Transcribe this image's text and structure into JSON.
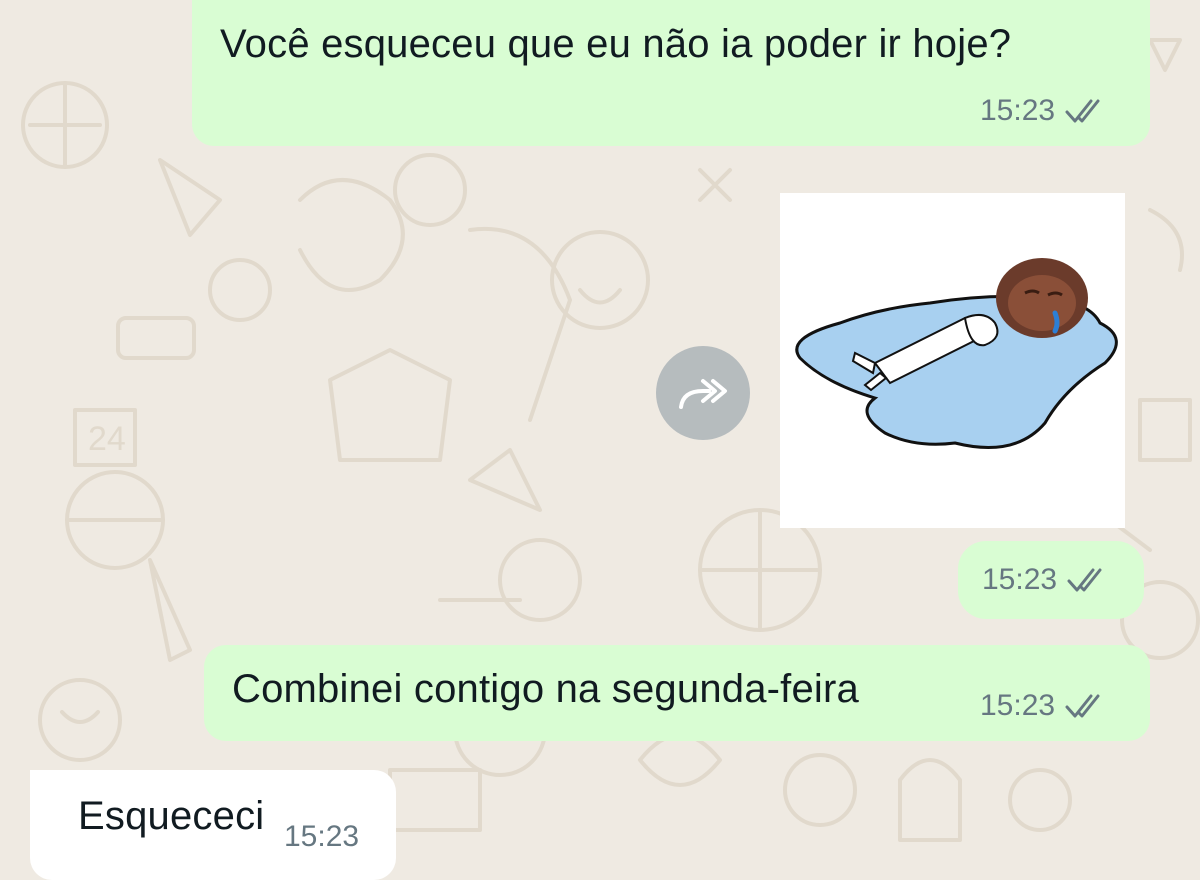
{
  "messages": [
    {
      "direction": "outgoing",
      "type": "text",
      "text": "Você esqueceu que eu não ia poder ir hoje?",
      "time": "15:23",
      "status": "read"
    },
    {
      "direction": "outgoing",
      "type": "sticker",
      "sticker_description": "person-lying-in-puddle-crying-sticker",
      "time": "15:23",
      "status": "read"
    },
    {
      "direction": "outgoing",
      "type": "text",
      "text": "Combinei contigo na segunda-feira",
      "time": "15:23",
      "status": "read"
    },
    {
      "direction": "incoming",
      "type": "text",
      "text": "Esquececi",
      "time": "15:23"
    }
  ],
  "icons": {
    "read_receipt": "double-check-icon",
    "forward": "forward-icon"
  },
  "colors": {
    "chat_background": "#efeae2",
    "outgoing_bubble": "#d9fdd3",
    "incoming_bubble": "#ffffff",
    "meta_text": "#667781",
    "message_text": "#111b21"
  }
}
